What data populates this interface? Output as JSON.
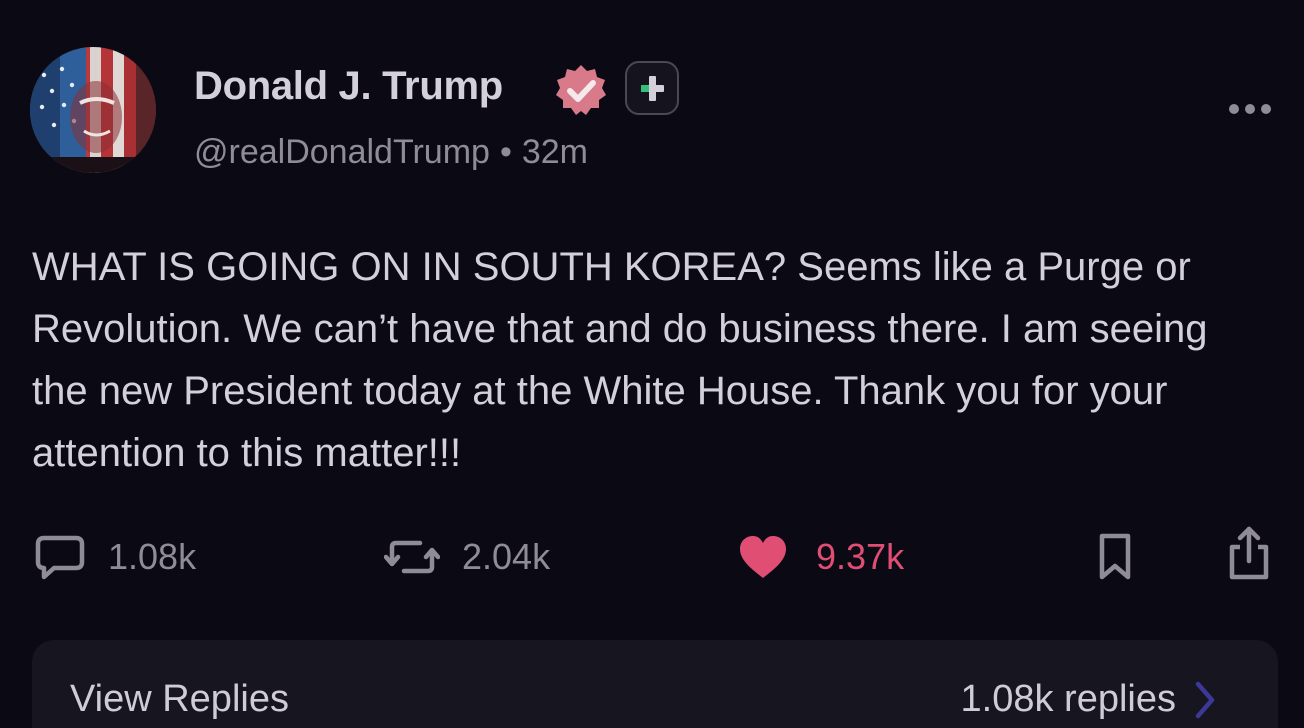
{
  "author": {
    "name": "Donald J. Trump",
    "handle": "@realDonaldTrump",
    "separator": "•",
    "time": "32m"
  },
  "post": {
    "text": "WHAT IS GOING ON IN SOUTH KOREA? Seems like a Purge or Revolution. We can’t have that and do business there. I am seeing the new President today at the White House. Thank you for your attention to this matter!!!"
  },
  "actions": {
    "replies": "1.08k",
    "reposts": "2.04k",
    "likes": "9.37k"
  },
  "replies_bar": {
    "label": "View Replies",
    "count": "1.08k replies"
  },
  "icons": {
    "avatar": "flag-portrait-avatar",
    "verified": "verified-badge-icon",
    "plus": "plus-badge-icon",
    "more": "more-dots-icon",
    "reply": "comment-icon",
    "repost": "repost-icon",
    "like": "heart-icon",
    "bookmark": "bookmark-icon",
    "share": "share-icon",
    "chevron": "chevron-right-icon"
  },
  "colors": {
    "background": "#0b0a14",
    "text": "#d4d0d9",
    "muted": "#8f8b97",
    "like": "#e04e74",
    "verified": "#d97a8a",
    "plus_green": "#33c17a",
    "chevron": "#3c3897"
  }
}
